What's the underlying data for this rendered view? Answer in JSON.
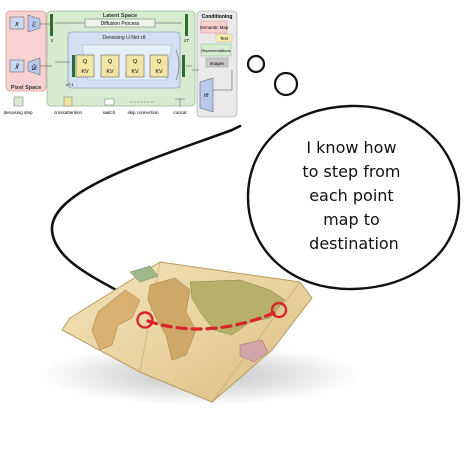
{
  "latent_diagram": {
    "pixel_space_label": "Pixel Space",
    "latent_space_label": "Latent Space",
    "diffusion_process_label": "Diffusion Process",
    "unet_label": "Denoising U-Net εθ",
    "conditioning_label": "Conditioning",
    "x_symbol": "x",
    "x_tilde_symbol": "x̃",
    "encoder_symbol": "ℰ",
    "decoder_symbol": "𝒟",
    "z_symbol": "z",
    "zt_symbol": "zT",
    "zt1_symbol": "zT-1",
    "tau_symbol": "τθ",
    "attention_q": "Q",
    "attention_kv": "KV",
    "conditioning_items": [
      "Semantic Map",
      "Text",
      "Representations",
      "Images"
    ],
    "legend": [
      "denoising step",
      "crossattention",
      "switch",
      "skip connection",
      "concat"
    ]
  },
  "thought_text": "I know how to step from each point map to destination",
  "colors": {
    "pixel_space_bg": "#f8d2d2",
    "latent_space_bg": "#d6ebd0",
    "unet_bg": "#d3dff2",
    "conditioning_bg": "#eaeaea",
    "route": "#d8232a"
  }
}
